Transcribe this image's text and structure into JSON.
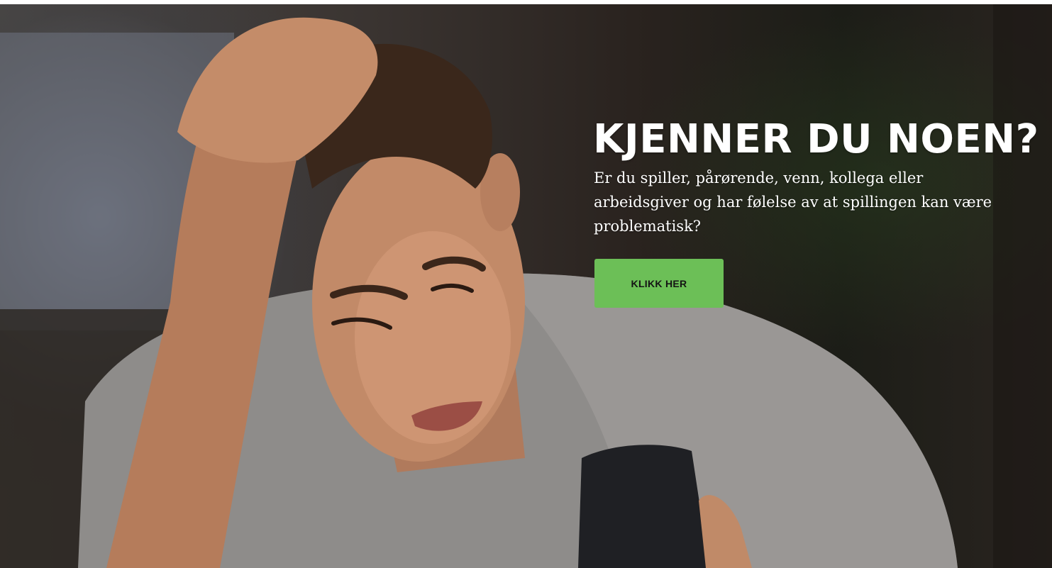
{
  "hero": {
    "headline": "KJENNER DU NOEN?",
    "subtext": "Er du spiller, pårørende, venn, kollega eller arbeidsgiver og har følelse av at spillingen kan være problematisk?",
    "button_label": "KLIKK HER",
    "button_color": "#6cbf57",
    "background_image": "man-holding-head-looking-at-phone"
  }
}
